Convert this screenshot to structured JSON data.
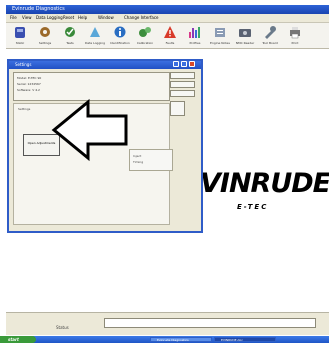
{
  "window": {
    "title": "Evinrude Diagnostics"
  },
  "menu": [
    "File",
    "View",
    "Data Logging",
    "Reset",
    "Help",
    "Window",
    "Change Interface"
  ],
  "toolbar": [
    {
      "label": "Static",
      "icon": "engine-icon",
      "color": "#3a4fb0"
    },
    {
      "label": "Settings",
      "icon": "settings-icon",
      "color": "#9b6a2a"
    },
    {
      "label": "Tests",
      "icon": "tests-icon",
      "color": "#3a8a3a"
    },
    {
      "label": "Data Logging",
      "icon": "data-logging-icon",
      "color": "#5aa7d8"
    },
    {
      "label": "Identification",
      "icon": "identification-icon",
      "color": "#2a6ec2"
    },
    {
      "label": "Calibration",
      "icon": "calibration-icon",
      "color": "#3d8e3d"
    },
    {
      "label": "Faults",
      "icon": "faults-warning-icon",
      "color": "#d83a2a"
    },
    {
      "label": "Profiles",
      "icon": "profiles-chart-icon",
      "color": "#8a3ab8"
    },
    {
      "label": "Engine Notes",
      "icon": "engine-notes-icon",
      "color": "#8a9bb4"
    },
    {
      "label": "NMC Reader",
      "icon": "nmc-reader-icon",
      "color": "#5a6272"
    },
    {
      "label": "Tool Board",
      "icon": "tool-board-icon",
      "color": "#6a7a8a"
    },
    {
      "label": "Print",
      "icon": "print-icon",
      "color": "#777777"
    }
  ],
  "dialog": {
    "title": "Settings",
    "info_lines": [
      "Model: E-TEC 90",
      "Serial: 1234567",
      "Software: V 4.2"
    ],
    "section_label": "Settings",
    "side_box_lines": [
      "Inject",
      "Timing"
    ],
    "button_label": "Open Adjustments"
  },
  "brand": {
    "name": "VINRUDE",
    "sub": "E-TEC"
  },
  "status": {
    "label": "Status"
  },
  "taskbar": {
    "start_label": "start",
    "tasks": [
      "Evinrude Diagnostics",
      "EVINRUDE.doc"
    ]
  }
}
